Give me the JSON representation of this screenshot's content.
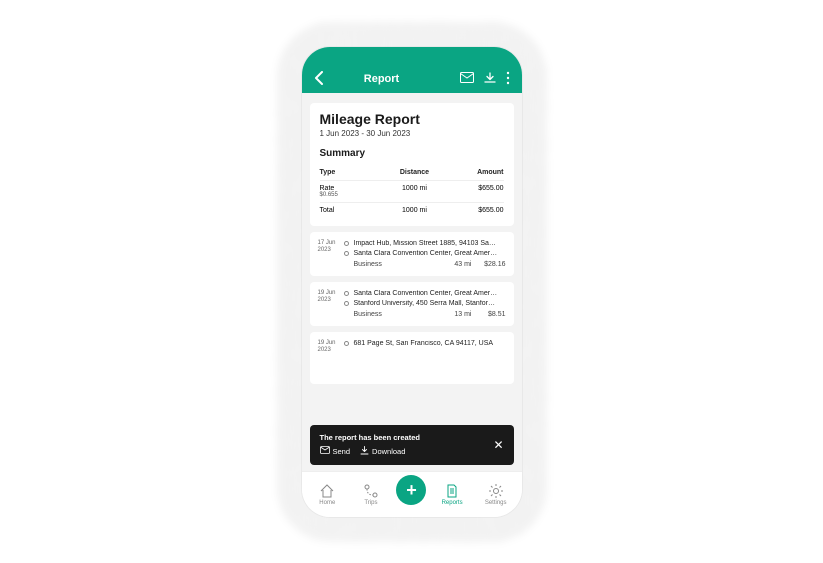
{
  "topbar": {
    "title": "Report"
  },
  "report": {
    "title": "Mileage Report",
    "date_range": "1 Jun 2023 - 30 Jun 2023",
    "summary_heading": "Summary",
    "columns": {
      "type": "Type",
      "distance": "Distance",
      "amount": "Amount"
    },
    "rows": [
      {
        "label": "Rate",
        "sub": "$0.655",
        "distance": "1000 mi",
        "amount": "$655.00"
      },
      {
        "label": "Total",
        "sub": "",
        "distance": "1000 mi",
        "amount": "$655.00"
      }
    ]
  },
  "trips": [
    {
      "date": "17 Jun 2023",
      "from": "Impact Hub, Mission Street 1885, 94103 Sa…",
      "to": "Santa Clara Convention Center, Great Amer…",
      "category": "Business",
      "distance": "43 mi",
      "amount": "$28.16"
    },
    {
      "date": "19 Jun 2023",
      "from": "Santa Clara Convention Center, Great Amer…",
      "to": "Stanford University, 450 Serra Mall, Stanfor…",
      "category": "Business",
      "distance": "13 mi",
      "amount": "$8.51"
    },
    {
      "date": "19 Jun 2023",
      "from": "681 Page St, San Francisco, CA 94117, USA",
      "to": "",
      "category": "",
      "distance": "",
      "amount": ""
    }
  ],
  "toast": {
    "message": "The report has been created",
    "send": "Send",
    "download": "Download"
  },
  "nav": {
    "home": "Home",
    "trips": "Trips",
    "reports": "Reports",
    "settings": "Settings"
  },
  "colors": {
    "accent": "#0aa583"
  }
}
